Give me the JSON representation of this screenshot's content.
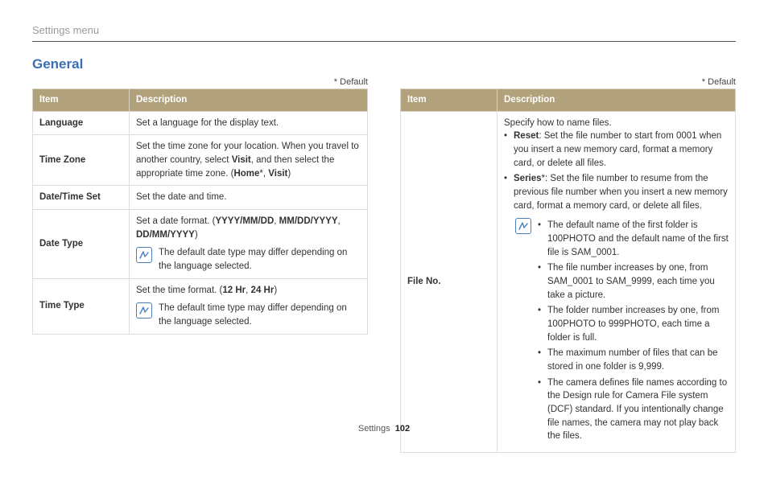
{
  "breadcrumb": "Settings menu",
  "section_title": "General",
  "default_note": "* Default",
  "headers": {
    "item": "Item",
    "description": "Description"
  },
  "left_table": {
    "rows": [
      {
        "item": "Language",
        "desc_plain": "Set a language for the display text."
      },
      {
        "item": "Time Zone",
        "desc_html": "Set the time zone for your location. When you travel to another country, select <b>Visit</b>, and then select the appropriate time zone. (<b>Home</b>*, <b>Visit</b>)"
      },
      {
        "item": "Date/Time Set",
        "desc_plain": "Set the date and time."
      },
      {
        "item": "Date Type",
        "desc_html": "Set a date format. (<b>YYYY/MM/DD</b>, <b>MM/DD/YYYY</b>, <b>DD/MM/YYYY</b>)",
        "note": "The default date type may differ depending on the language selected."
      },
      {
        "item": "Time Type",
        "desc_html": "Set the time format. (<b>12 Hr</b>, <b>24 Hr</b>)",
        "note": "The default time type may differ depending on the language selected."
      }
    ]
  },
  "right_table": {
    "item": "File No.",
    "intro": "Specify how to name files.",
    "bullets": [
      "<b>Reset</b>: Set the file number to start from 0001 when you insert a new memory card, format a memory card, or delete all files.",
      "<b>Series</b>*: Set the file number to resume from the previous file number when you insert a new memory card, format a memory card, or delete all files."
    ],
    "note_bullets": [
      "The default name of the first folder is 100PHOTO and the default name of the first file is SAM_0001.",
      "The file number increases by one, from SAM_0001 to SAM_9999, each time you take a picture.",
      "The folder number increases by one, from 100PHOTO to 999PHOTO, each time a folder is full.",
      "The maximum number of files that can be stored in one folder is 9,999.",
      "The camera defines file names according to the Design rule for Camera File system (DCF) standard. If you intentionally change file names, the camera may not play back the files."
    ]
  },
  "footer": {
    "section": "Settings",
    "page": "102"
  }
}
